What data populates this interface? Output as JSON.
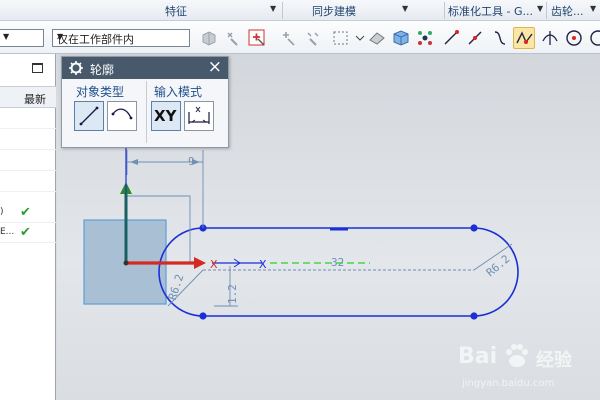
{
  "ribbon": {
    "groups": [
      "特征",
      "同步建模",
      "标准化工具 - G...",
      "齿轮..."
    ]
  },
  "toolbar": {
    "selection_filter_value": "",
    "scope_filter_value": "仅在工作部件内"
  },
  "navigator": {
    "column_header": "最新",
    "rows": [
      {
        "text": "",
        "check": ""
      },
      {
        "text": "",
        "check": ""
      },
      {
        "text": "",
        "check": ""
      },
      {
        "text": "",
        "check": ""
      },
      {
        "text": ")",
        "check": "✔"
      },
      {
        "text": "E...",
        "check": "✔"
      }
    ]
  },
  "profile_dialog": {
    "title": "轮廓",
    "close_glyph": "×",
    "object_type_label": "对象类型",
    "input_mode_label": "输入模式",
    "xy_label": "XY"
  },
  "sketch": {
    "dimensions": {
      "top_width": "9",
      "length": "32",
      "radius_left": "R6.2",
      "radius_right": "R6.2",
      "offset": "1.2"
    },
    "axis_labels": {
      "x_origin": "X",
      "x_cursor": "X"
    }
  },
  "colors": {
    "sketch_curve": "#1a2fd6",
    "dimension": "#6f8fb4",
    "x_axis": "#d42a22",
    "y_axis": "#2a8a2a",
    "inference_line": "#2ad12a",
    "dialog_title_bg": "#47596a",
    "active_tool_bg": "#fbe7a5"
  },
  "watermark": {
    "brand": "Bai",
    "brand_suffix": "经验",
    "url": "jingyan.baidu.com"
  }
}
